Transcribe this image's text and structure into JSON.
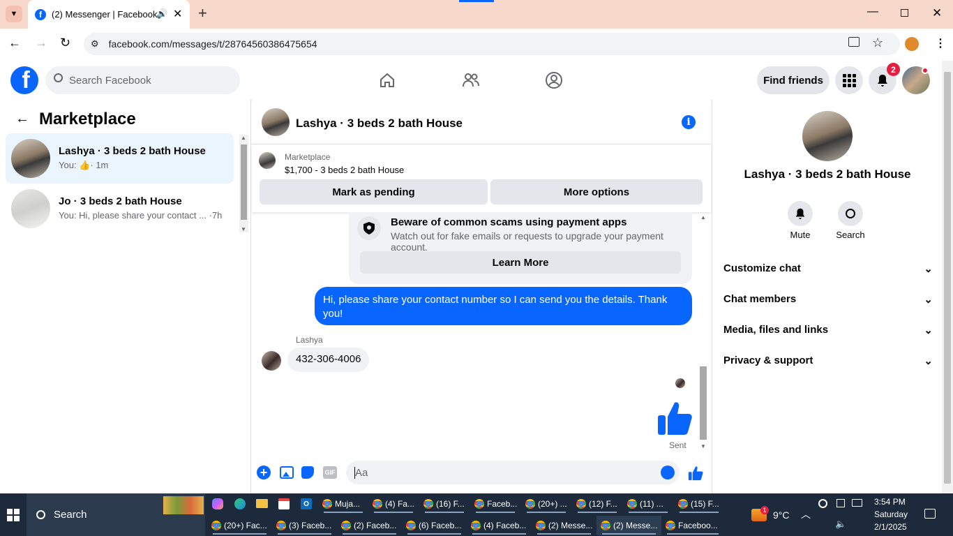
{
  "browser": {
    "tab_title": "(2) Messenger | Facebook",
    "url": "facebook.com/messages/t/28764560386475654"
  },
  "header": {
    "search_placeholder": "Search Facebook",
    "find_friends": "Find friends",
    "notification_count": "2"
  },
  "sidebar": {
    "title": "Marketplace",
    "conversations": [
      {
        "name": "Lashya · 3 beds 2 bath House",
        "preview_prefix": "You:",
        "time": "· 1m"
      },
      {
        "name": "Jo · 3 beds 2 bath House",
        "preview": "You: Hi, please share your contact ...",
        "time": "·7h"
      }
    ]
  },
  "chat": {
    "title": "Lashya · 3 beds 2 bath House",
    "listing_source": "Marketplace",
    "listing_text": "$1,700 - 3 beds 2 bath House",
    "mark_pending": "Mark as pending",
    "more_options": "More options",
    "warning_title": "Beware of common scams using payment apps",
    "warning_body": "Watch out for fake emails or requests to upgrade your payment account.",
    "learn_more": "Learn More",
    "outgoing_message": "Hi, please share your contact number so I can send you the details. Thank you!",
    "incoming_sender": "Lashya",
    "incoming_message": "432-306-4006",
    "sent_status": "Sent",
    "composer_placeholder": "Aa",
    "gif_label": "GIF"
  },
  "details": {
    "name": "Lashya · 3 beds 2 bath House",
    "mute": "Mute",
    "search": "Search",
    "sections": [
      "Customize chat",
      "Chat members",
      "Media, files and links",
      "Privacy & support"
    ]
  },
  "taskbar": {
    "search": "Search",
    "row1": [
      "Muja...",
      "(4) Fa...",
      "(16) F...",
      "Faceb...",
      "(20+) ...",
      "(12) F...",
      "(11) ...",
      "(15) F..."
    ],
    "row2": [
      "(20+) Fac...",
      "(3) Faceb...",
      "(2) Faceb...",
      "(6) Faceb...",
      "(4) Faceb...",
      "(2) Messe...",
      "(2) Messe...",
      "Faceboo..."
    ],
    "weather": "9°C",
    "weather_badge": "1",
    "time": "3:54 PM",
    "day": "Saturday",
    "date": "2/1/2025"
  },
  "colors": {
    "brand": "#0866ff",
    "tab_strip": "#f9d8cc",
    "taskbar": "#1c2a3b",
    "badge": "#e41e3f"
  }
}
